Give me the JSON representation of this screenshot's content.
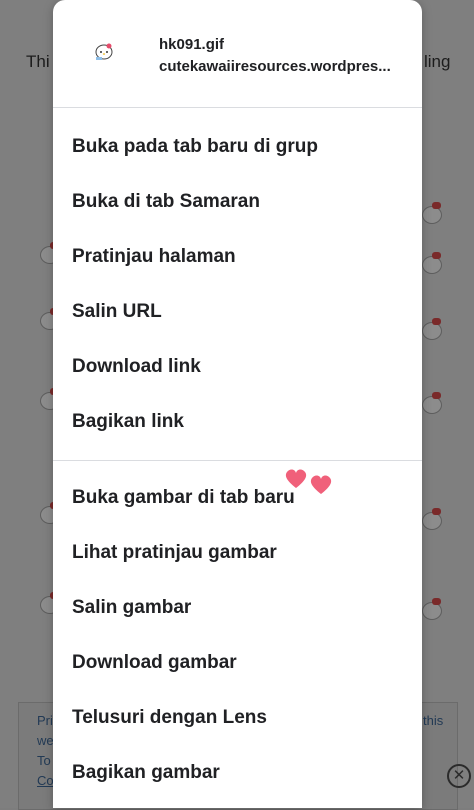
{
  "background": {
    "text_left": "Thi",
    "text_right": "ling",
    "banner_lines_left": [
      "Pri",
      "we",
      "To",
      "Co"
    ],
    "banner_line_right": "this",
    "close_glyph": "✕"
  },
  "header": {
    "file_name": "hk091.gif",
    "source": "cutekawaiiresources.wordpres..."
  },
  "link_actions": [
    {
      "label": "Buka pada tab baru di grup"
    },
    {
      "label": "Buka di tab Samaran"
    },
    {
      "label": "Pratinjau halaman"
    },
    {
      "label": "Salin URL"
    },
    {
      "label": "Download link"
    },
    {
      "label": "Bagikan link"
    }
  ],
  "image_actions": [
    {
      "label": "Buka gambar di tab baru"
    },
    {
      "label": "Lihat pratinjau gambar"
    },
    {
      "label": "Salin gambar"
    },
    {
      "label": "Download gambar"
    },
    {
      "label": "Telusuri dengan Lens"
    },
    {
      "label": "Bagikan gambar"
    }
  ],
  "colors": {
    "menu_background": "#ffffff",
    "text": "#202124",
    "divider": "#dadce0",
    "scrim": "#7f7f7f",
    "heart": "#f0607a"
  },
  "icons": {
    "thumbnail": "hello-kitty-thumbnail-icon",
    "decoration": "hearts-icon",
    "ad_close": "close-circle-icon"
  }
}
